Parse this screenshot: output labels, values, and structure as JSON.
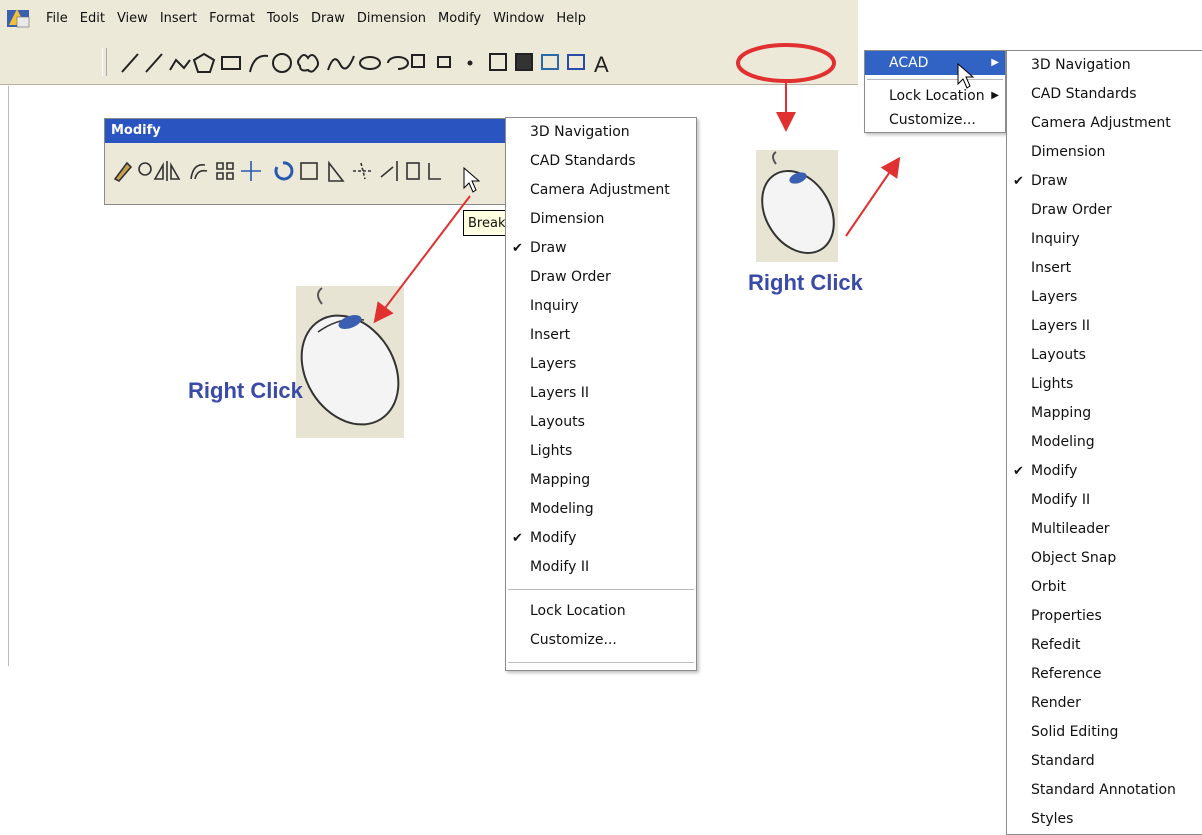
{
  "menubar": {
    "items": [
      "File",
      "Edit",
      "View",
      "Insert",
      "Format",
      "Tools",
      "Draw",
      "Dimension",
      "Modify",
      "Window",
      "Help"
    ]
  },
  "draw_toolbar": {
    "text_tool_label": "A"
  },
  "modify_toolbar": {
    "title": "Modify",
    "tooltip": "Break"
  },
  "context_menu_1": {
    "items": [
      {
        "label": "3D Navigation",
        "checked": false
      },
      {
        "label": "CAD Standards",
        "checked": false
      },
      {
        "label": "Camera Adjustment",
        "checked": false
      },
      {
        "label": "Dimension",
        "checked": false
      },
      {
        "label": "Draw",
        "checked": true
      },
      {
        "label": "Draw Order",
        "checked": false
      },
      {
        "label": "Inquiry",
        "checked": false
      },
      {
        "label": "Insert",
        "checked": false
      },
      {
        "label": "Layers",
        "checked": false
      },
      {
        "label": "Layers II",
        "checked": false
      },
      {
        "label": "Layouts",
        "checked": false
      },
      {
        "label": "Lights",
        "checked": false
      },
      {
        "label": "Mapping",
        "checked": false
      },
      {
        "label": "Modeling",
        "checked": false
      },
      {
        "label": "Modify",
        "checked": true
      },
      {
        "label": "Modify II",
        "checked": false
      }
    ],
    "lock_location": "Lock Location",
    "customize": "Customize..."
  },
  "acad_menu": {
    "acad": "ACAD",
    "lock_location": "Lock Location",
    "customize": "Customize..."
  },
  "submenu": {
    "items": [
      {
        "label": "3D Navigation",
        "checked": false
      },
      {
        "label": "CAD Standards",
        "checked": false
      },
      {
        "label": "Camera Adjustment",
        "checked": false
      },
      {
        "label": "Dimension",
        "checked": false
      },
      {
        "label": "Draw",
        "checked": true
      },
      {
        "label": "Draw Order",
        "checked": false
      },
      {
        "label": "Inquiry",
        "checked": false
      },
      {
        "label": "Insert",
        "checked": false
      },
      {
        "label": "Layers",
        "checked": false
      },
      {
        "label": "Layers II",
        "checked": false
      },
      {
        "label": "Layouts",
        "checked": false
      },
      {
        "label": "Lights",
        "checked": false
      },
      {
        "label": "Mapping",
        "checked": false
      },
      {
        "label": "Modeling",
        "checked": false
      },
      {
        "label": "Modify",
        "checked": true
      },
      {
        "label": "Modify II",
        "checked": false
      },
      {
        "label": "Multileader",
        "checked": false
      },
      {
        "label": "Object Snap",
        "checked": false
      },
      {
        "label": "Orbit",
        "checked": false
      },
      {
        "label": "Properties",
        "checked": false
      },
      {
        "label": "Refedit",
        "checked": false
      },
      {
        "label": "Reference",
        "checked": false
      },
      {
        "label": "Render",
        "checked": false
      },
      {
        "label": "Solid Editing",
        "checked": false
      },
      {
        "label": "Standard",
        "checked": false
      },
      {
        "label": "Standard Annotation",
        "checked": false
      },
      {
        "label": "Styles",
        "checked": false
      }
    ]
  },
  "captions": {
    "left": "Right Click",
    "right": "Right Click"
  },
  "colors": {
    "caption": "#3a4aa8",
    "arrow": "#e03030",
    "highlight": "#3163c5",
    "titlebar": "#2a55c0"
  }
}
